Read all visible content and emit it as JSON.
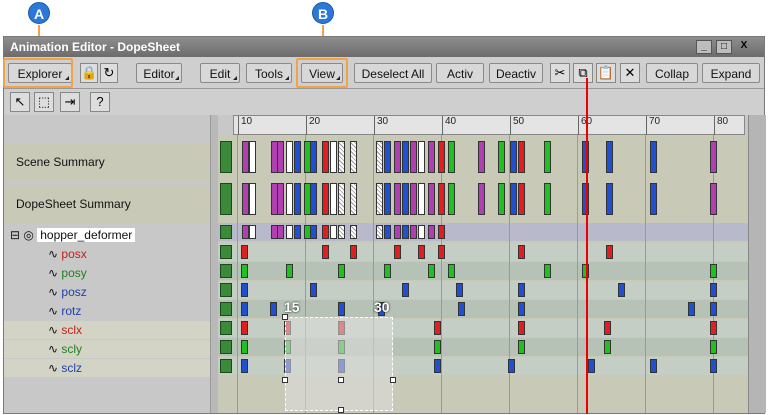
{
  "callouts": {
    "a": "A",
    "b": "B"
  },
  "window": {
    "title": "Animation Editor - DopeSheet",
    "minimize": "_",
    "maximize": "□",
    "close": "X"
  },
  "toolbar": {
    "explorer": "Explorer",
    "editor": "Editor",
    "edit": "Edit",
    "tools": "Tools",
    "view": "View",
    "deselect_all": "Deselect All",
    "activ": "Activ",
    "deactiv": "Deactiv",
    "collap": "Collap",
    "expand": "Expand"
  },
  "ruler": {
    "ticks": [
      "10",
      "20",
      "30",
      "40",
      "50",
      "60",
      "70",
      "80"
    ]
  },
  "tree": {
    "scene_summary": "Scene Summary",
    "dopesheet_summary": "DopeSheet Summary",
    "root": "hopper_deformer",
    "params": [
      {
        "label": "posx",
        "color": "#c02020"
      },
      {
        "label": "posy",
        "color": "#208020"
      },
      {
        "label": "posz",
        "color": "#2040b0"
      },
      {
        "label": "rotz",
        "color": "#2040b0"
      },
      {
        "label": "sclx",
        "color": "#c02020"
      },
      {
        "label": "scly",
        "color": "#208020"
      },
      {
        "label": "sclz",
        "color": "#2040b0"
      }
    ]
  },
  "selection": {
    "start": "15",
    "end": "30"
  },
  "key_colors": {
    "red": "#e02020",
    "green": "#20c020",
    "blue": "#2050d0",
    "purple": "#b040b0",
    "white": "#ffffff"
  }
}
